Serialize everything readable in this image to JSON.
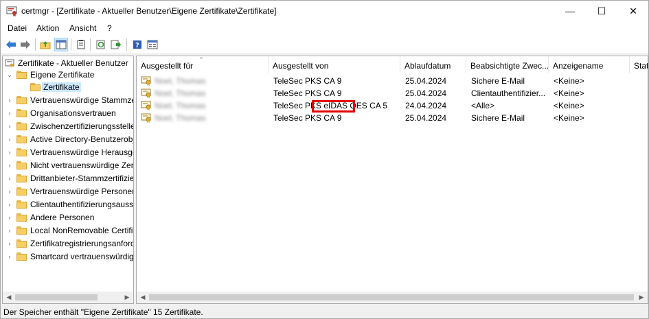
{
  "window": {
    "title": "certmgr - [Zertifikate - Aktueller Benutzer\\Eigene Zertifikate\\Zertifikate]",
    "minimize_symbol": "—",
    "maximize_symbol": "☐",
    "close_symbol": "✕"
  },
  "menu": {
    "items": [
      "Datei",
      "Aktion",
      "Ansicht",
      "?"
    ]
  },
  "toolbar": {
    "buttons": [
      "back-icon",
      "forward-icon",
      "up-folder-icon",
      "show-hide-tree-icon",
      "properties-icon",
      "refresh-icon",
      "export-icon",
      "help-icon",
      "console-icon"
    ]
  },
  "tree": {
    "root": "Zertifikate - Aktueller Benutzer",
    "items": [
      "Eigene Zertifikate",
      "Zertifikate",
      "Vertrauenswürdige Stammzer",
      "Organisationsvertrauen",
      "Zwischenzertifizierungsstellen",
      "Active Directory-Benutzerobj",
      "Vertrauenswürdige Herausgeb",
      "Nicht vertrauenswürdige Zert",
      "Drittanbieter-Stammzertifizie",
      "Vertrauenswürdige Personen",
      "Clientauthentifizierungsausst",
      "Andere Personen",
      "Local NonRemovable Certific",
      "Zertifikatregistrierungsanford",
      "Smartcard vertrauenswürdige"
    ]
  },
  "list": {
    "columns": [
      "Ausgestellt für",
      "Ausgestellt von",
      "Ablaufdatum",
      "Beabsichtigte Zwec...",
      "Anzeigename",
      "Stat"
    ],
    "rows": [
      {
        "issued_to": "Noel, Thomas",
        "issued_by": "TeleSec PKS CA 9",
        "expires": "25.04.2024",
        "purpose": "Sichere E-Mail",
        "display": "<Keine>"
      },
      {
        "issued_to": "Noel, Thomas",
        "issued_by": "TeleSec PKS CA 9",
        "expires": "25.04.2024",
        "purpose": "Clientauthentifizier...",
        "display": "<Keine>"
      },
      {
        "issued_to": "Noel, Thomas",
        "issued_by": "TeleSec PKS eIDAS QES CA 5",
        "expires": "24.04.2024",
        "purpose": "<Alle>",
        "display": "<Keine>"
      },
      {
        "issued_to": "Noel, Thomas",
        "issued_by": "TeleSec PKS CA 9",
        "expires": "25.04.2024",
        "purpose": "Sichere E-Mail",
        "display": "<Keine>"
      }
    ]
  },
  "status": {
    "text": "Der Speicher enthält \"Eigene Zertifikate\" 15 Zertifikate."
  },
  "colors": {
    "highlight": "#e30000",
    "selection": "#cce8ff",
    "folder": "#f5cf61"
  }
}
